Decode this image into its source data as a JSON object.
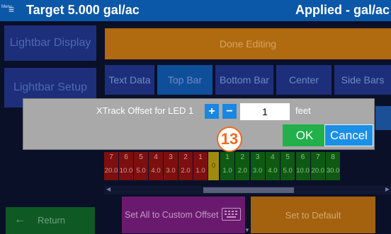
{
  "header": {
    "menu_label": "Menu",
    "menu_icon": "≡",
    "target": "Target 5.000 gal/ac",
    "applied": "Applied - gal/ac"
  },
  "sidebar": {
    "lightbar_display": "Lightbar Display",
    "lightbar_setup": "Lightbar Setup"
  },
  "done_editing": "Done Editing",
  "tabs": [
    {
      "label": "Text Data"
    },
    {
      "label": "Top Bar"
    },
    {
      "label": "Bottom Bar"
    },
    {
      "label": "Center"
    },
    {
      "label": "Side Bars"
    }
  ],
  "leds": [
    {
      "num": "7",
      "val": "20.0",
      "kind": "red"
    },
    {
      "num": "6",
      "val": "10.0",
      "kind": "red"
    },
    {
      "num": "5",
      "val": "5.0",
      "kind": "red"
    },
    {
      "num": "4",
      "val": "4.0",
      "kind": "red"
    },
    {
      "num": "3",
      "val": "3.0",
      "kind": "red"
    },
    {
      "num": "2",
      "val": "2.0",
      "kind": "red"
    },
    {
      "num": "1",
      "val": "1.0",
      "kind": "red"
    },
    {
      "num": "",
      "val": "0",
      "kind": "center"
    },
    {
      "num": "1",
      "val": "1.0",
      "kind": "green"
    },
    {
      "num": "2",
      "val": "2.0",
      "kind": "green"
    },
    {
      "num": "3",
      "val": "3.0",
      "kind": "green"
    },
    {
      "num": "4",
      "val": "4.0",
      "kind": "green"
    },
    {
      "num": "5",
      "val": "5.0",
      "kind": "green"
    },
    {
      "num": "6",
      "val": "10.0",
      "kind": "green"
    },
    {
      "num": "7",
      "val": "20.0",
      "kind": "green"
    },
    {
      "num": "8",
      "val": "30.0",
      "kind": "green"
    }
  ],
  "bottom": {
    "return": "Return",
    "return_icon": "←",
    "custom_offset": "Set All to Custom Offset",
    "set_default": "Set to Default"
  },
  "dialog": {
    "label": "XTrack Offset for LED 1",
    "plus": "+",
    "minus": "−",
    "value": "1",
    "unit": "feet",
    "ok": "OK",
    "cancel": "Cancel"
  },
  "step_badge": "13",
  "colors": {
    "header": "#0b57a8",
    "ok": "#21b04b",
    "cancel": "#1a8fe6",
    "badge": "#f06a1d"
  }
}
